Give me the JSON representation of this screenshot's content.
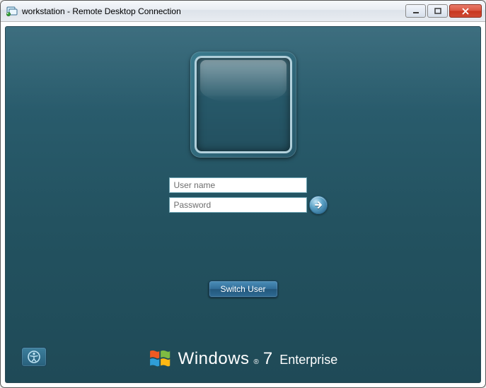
{
  "window": {
    "title": "workstation - Remote Desktop Connection"
  },
  "login": {
    "username_placeholder": "User name",
    "username_value": "",
    "password_placeholder": "Password",
    "password_value": ""
  },
  "buttons": {
    "switch_user": "Switch User"
  },
  "branding": {
    "product": "Windows",
    "version": "7",
    "edition": "Enterprise",
    "reg": "®"
  }
}
